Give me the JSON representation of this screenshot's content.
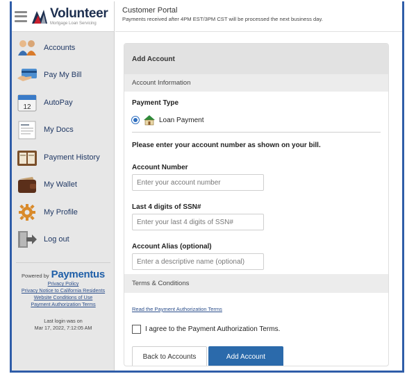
{
  "brand": {
    "name": "Volunteer",
    "tagline": "Mortgage Loan Servicing"
  },
  "header": {
    "title": "Customer Portal",
    "notice": "Payments received after 4PM EST/3PM CST will be processed the next business day."
  },
  "sidebar": {
    "items": [
      {
        "label": "Accounts",
        "icon": "accounts-icon"
      },
      {
        "label": "Pay My Bill",
        "icon": "pay-bill-icon"
      },
      {
        "label": "AutoPay",
        "icon": "calendar-icon"
      },
      {
        "label": "My Docs",
        "icon": "documents-icon"
      },
      {
        "label": "Payment History",
        "icon": "history-icon"
      },
      {
        "label": "My Wallet",
        "icon": "wallet-icon"
      },
      {
        "label": "My Profile",
        "icon": "gear-icon"
      },
      {
        "label": "Log out",
        "icon": "logout-icon"
      }
    ],
    "footer": {
      "powered_by": "Powered by",
      "powered_brand": "Paymentus",
      "links": [
        "Privacy Policy",
        "Privacy Notice to California Residents",
        "Website Conditions of Use",
        "Payment Authorization Terms"
      ],
      "last_login_label": "Last login was on",
      "last_login_value": "Mar 17, 2022, 7:12:05 AM"
    }
  },
  "form": {
    "title": "Add Account",
    "section_account": "Account Information",
    "payment_type_label": "Payment Type",
    "payment_type_option": "Loan Payment",
    "instruction": "Please enter your account number as shown on your bill.",
    "account_number": {
      "label": "Account Number",
      "placeholder": "Enter your account number",
      "value": ""
    },
    "ssn": {
      "label": "Last 4 digits of SSN#",
      "placeholder": "Enter your last 4 digits of SSN#",
      "value": ""
    },
    "alias": {
      "label": "Account Alias (optional)",
      "placeholder": "Enter a descriptive name (optional)",
      "value": ""
    },
    "section_terms": "Terms & Conditions",
    "terms_link": "Read the Payment Authorization Terms",
    "agree_label": "I agree to the Payment Authorization Terms.",
    "back_button": "Back to Accounts",
    "submit_button": "Add Account"
  },
  "colors": {
    "frame_border": "#2f5da8",
    "primary_button": "#2b6aab",
    "sidebar_bg": "#e7e7e7",
    "brand_red": "#c8202f",
    "brand_navy": "#1d2f4f"
  }
}
